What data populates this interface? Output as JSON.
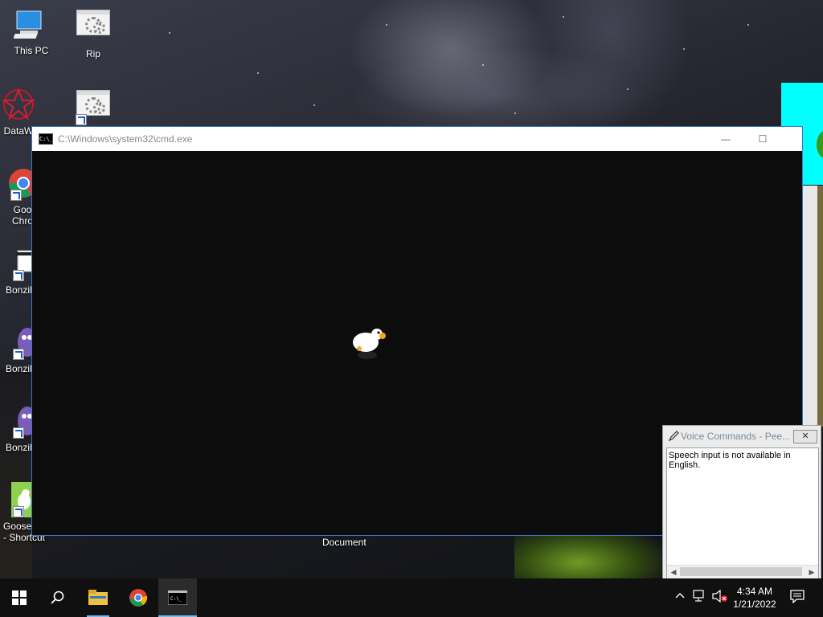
{
  "desktop": {
    "icons": [
      {
        "label": "This PC"
      },
      {
        "label": "Rip"
      },
      {
        "label": "DataW"
      },
      {
        "label": "Goo\nChro"
      },
      {
        "label": "BonziB"
      },
      {
        "label": "BonziB"
      },
      {
        "label": "BonziB"
      },
      {
        "label": "Goose\n- Shortcut"
      }
    ],
    "document_label": "Document"
  },
  "cmd_window": {
    "title": "C:\\Windows\\system32\\cmd.exe",
    "minimize": "—",
    "maximize": "☐"
  },
  "voice_commands": {
    "title": "Voice Commands - Pee...",
    "close": "✕",
    "message": "Speech input is not available in English."
  },
  "taskbar": {
    "start_icon": "windows-logo",
    "search_icon": "search",
    "apps": [
      "file-explorer",
      "google-chrome",
      "command-prompt"
    ],
    "time": "4:34 AM",
    "date": "1/21/2022"
  },
  "colors": {
    "accent": "#76b9ed",
    "cyan_window": "#00ffff",
    "console_bg": "#0c0c0c"
  }
}
